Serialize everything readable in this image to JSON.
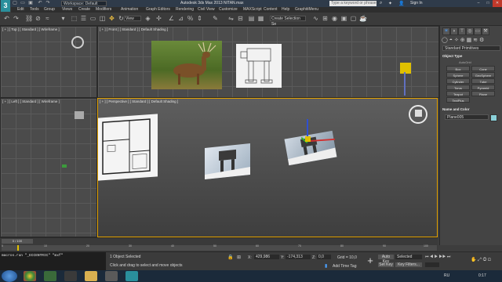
{
  "titlebar": {
    "app_icon": "3",
    "workspace": "Workspace: Default",
    "window_title": "Autodesk 3ds Max 2013    NITAN.max",
    "search_placeholder": "Type a keyword or phrase",
    "sign_in": "Sign In",
    "minimize": "–",
    "maximize": "□",
    "close": "✕"
  },
  "menubar": {
    "items": [
      "Edit",
      "Tools",
      "Group",
      "Views",
      "Create",
      "Modifiers",
      "Animation",
      "Graph Editors",
      "Rendering",
      "Civil View",
      "Customize",
      "MAXScript",
      "Content",
      "Help",
      "GraphitiMenu"
    ]
  },
  "toolbar": {
    "view_dropdown": "View",
    "selection_set": "Create Selection Se"
  },
  "viewports": {
    "top": "[ + ] [ Top ] [ Standard ] [ Wireframe ]",
    "front": "[ + ] [ Front ] [ Standard ] [ Default Shading ]",
    "left": "[ + ] [ Left ] [ Standard ] [ Wireframe ]",
    "perspective": "[ + ] [ Perspective ] [ Standard ] [ Default Shading ]"
  },
  "command_panel": {
    "category": "Standard Primitives",
    "object_type_header": "Object Type",
    "autogrid": "AutoGrid",
    "buttons": [
      "Box",
      "Cone",
      "Sphere",
      "GeoSphere",
      "Cylinder",
      "Tube",
      "Torus",
      "Pyramid",
      "Teapot",
      "Plane",
      "TextPlus"
    ],
    "name_color_header": "Name and Color",
    "object_name": "Plane005"
  },
  "timeline": {
    "slider": "0 / 100",
    "ticks": [
      "0",
      "5",
      "10",
      "15",
      "20",
      "25",
      "30",
      "35",
      "40",
      "45",
      "50",
      "55",
      "60",
      "65",
      "70",
      "75",
      "80",
      "85",
      "90",
      "95",
      "100"
    ]
  },
  "status": {
    "maxscript_line": "macros.run \"_ECCENTRIC\" \"mxf\"",
    "selected": "1 Object Selected",
    "prompt": "Click and drag to select and move objects",
    "x_label": "X:",
    "x_value": "429,986",
    "y_label": "Y:",
    "y_value": "-174,313",
    "z_label": "Z:",
    "z_value": "0,0",
    "grid": "Grid = 10,0",
    "autokey": "Auto Key",
    "autokey_value": "Selected",
    "setkey": "Set Key",
    "key_filters": "Key Filters...",
    "add_time_tag": "Add Time Tag"
  },
  "taskbar": {
    "lang": "RU",
    "time": "0:17"
  }
}
